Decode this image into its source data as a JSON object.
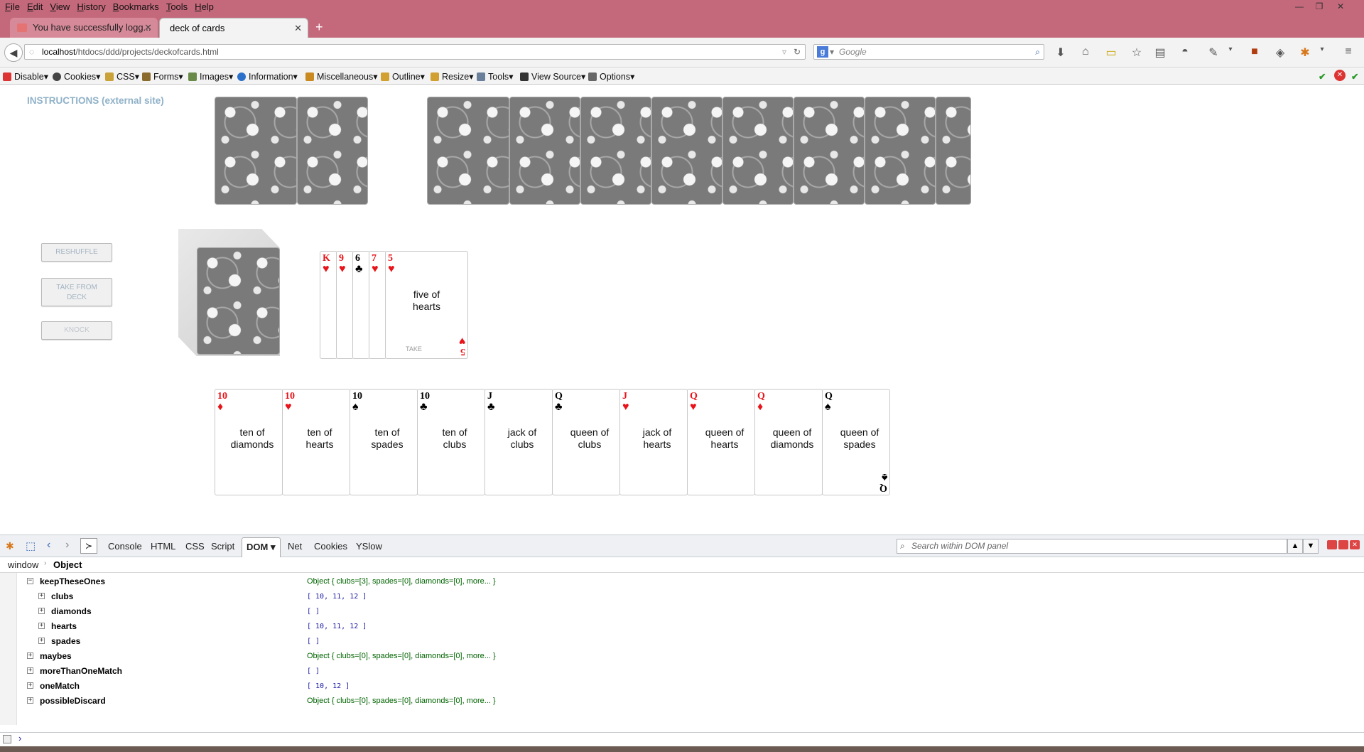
{
  "browser": {
    "menu": [
      "File",
      "Edit",
      "View",
      "History",
      "Bookmarks",
      "Tools",
      "Help"
    ],
    "tabs": [
      {
        "label": "You have successfully logg...",
        "active": false
      },
      {
        "label": "deck of cards",
        "active": true
      }
    ],
    "new_tab": "+",
    "url_host": "localhost",
    "url_path": "/htdocs/ddd/projects/deckofcards.html",
    "search_engine": "Google",
    "accent": "#c4697b"
  },
  "devbar": {
    "items": [
      "Disable",
      "Cookies",
      "CSS",
      "Forms",
      "Images",
      "Information",
      "Miscellaneous",
      "Outline",
      "Resize",
      "Tools",
      "View Source",
      "Options"
    ]
  },
  "page": {
    "instructions_link": "INSTRUCTIONS (external site)",
    "buttons": {
      "reshuffle": "RESHUFFLE",
      "take_from_deck": "TAKE FROM DECK",
      "knock": "KNOCK"
    },
    "discard": {
      "cards": [
        {
          "rank": "K",
          "suit": "♥",
          "color": "red"
        },
        {
          "rank": "9",
          "suit": "♥",
          "color": "red"
        },
        {
          "rank": "6",
          "suit": "♣",
          "color": "black"
        },
        {
          "rank": "7",
          "suit": "♥",
          "color": "red"
        },
        {
          "rank": "5",
          "suit": "♥",
          "color": "red"
        }
      ],
      "top_name": "five of hearts",
      "take_label": "TAKE",
      "top_corner_rank": "5",
      "top_corner_suit": "♥"
    },
    "hand": [
      {
        "rank": "10",
        "suit": "♦",
        "color": "red",
        "name": "ten of diamonds"
      },
      {
        "rank": "10",
        "suit": "♥",
        "color": "red",
        "name": "ten of hearts"
      },
      {
        "rank": "10",
        "suit": "♠",
        "color": "black",
        "name": "ten of spades"
      },
      {
        "rank": "10",
        "suit": "♣",
        "color": "black",
        "name": "ten of clubs"
      },
      {
        "rank": "J",
        "suit": "♣",
        "color": "black",
        "name": "jack of clubs"
      },
      {
        "rank": "Q",
        "suit": "♣",
        "color": "black",
        "name": "queen of clubs"
      },
      {
        "rank": "J",
        "suit": "♥",
        "color": "red",
        "name": "jack of hearts"
      },
      {
        "rank": "Q",
        "suit": "♥",
        "color": "red",
        "name": "queen of hearts"
      },
      {
        "rank": "Q",
        "suit": "♦",
        "color": "red",
        "name": "queen of diamonds"
      },
      {
        "rank": "Q",
        "suit": "♠",
        "color": "black",
        "name": "queen of spades"
      }
    ],
    "last_corner_rank": "Q",
    "last_corner_suit": "♠"
  },
  "firebug": {
    "tabs": [
      "Console",
      "HTML",
      "CSS",
      "Script",
      "DOM",
      "Net",
      "Cookies",
      "YSlow"
    ],
    "selected_tab": "DOM",
    "search_placeholder": "Search within DOM panel",
    "path": [
      "window",
      "Object"
    ],
    "rows": [
      {
        "key": "keepTheseOnes",
        "toggle": "−",
        "value": "Object { clubs=[3],  spades=[0],  diamonds=[0],  more... }",
        "type": "obj",
        "level": 0
      },
      {
        "key": "clubs",
        "toggle": "+",
        "value": "[ 10,  11,  12 ]",
        "type": "arr",
        "level": 1
      },
      {
        "key": "diamonds",
        "toggle": "+",
        "value": "[ ]",
        "type": "arr",
        "level": 1
      },
      {
        "key": "hearts",
        "toggle": "+",
        "value": "[ 10,  11,  12 ]",
        "type": "arr",
        "level": 1
      },
      {
        "key": "spades",
        "toggle": "+",
        "value": "[ ]",
        "type": "arr",
        "level": 1
      },
      {
        "key": "maybes",
        "toggle": "+",
        "value": "Object { clubs=[0],  spades=[0],  diamonds=[0],  more... }",
        "type": "obj",
        "level": 0
      },
      {
        "key": "moreThanOneMatch",
        "toggle": "+",
        "value": "[ ]",
        "type": "arr",
        "level": 0
      },
      {
        "key": "oneMatch",
        "toggle": "+",
        "value": "[ 10,  12 ]",
        "type": "arr",
        "level": 0
      },
      {
        "key": "possibleDiscard",
        "toggle": "+",
        "value": "Object { clubs=[0],  spades=[0],  diamonds=[0],  more... }",
        "type": "obj",
        "level": 0
      }
    ],
    "prompt": "›"
  }
}
